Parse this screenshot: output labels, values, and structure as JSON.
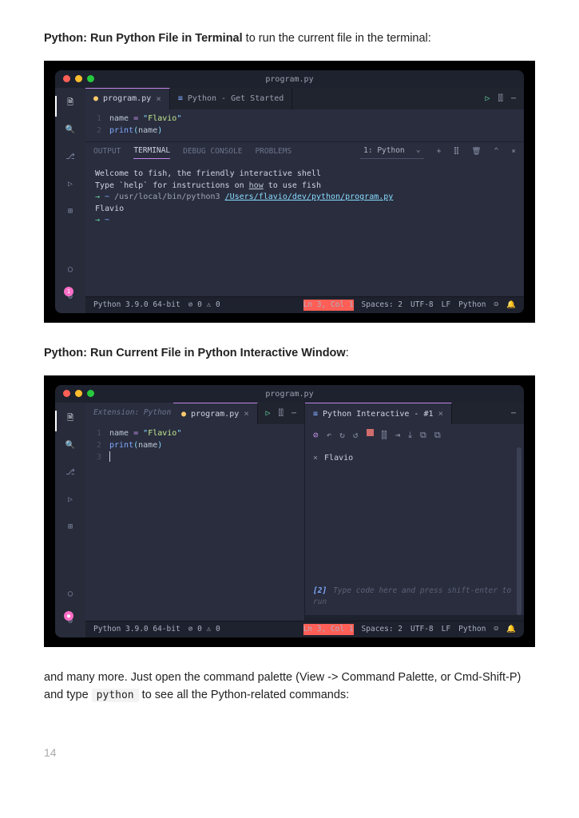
{
  "intro": {
    "bold1": "Python: Run Python File in Terminal",
    "rest1": " to run the current file in the terminal:",
    "bold2": "Python: Run Current File in Python Interactive Window",
    "colon2": ":",
    "outro1": "and many more. Just open the command palette (View -> Command Palette, or Cmd-Shift-P) and type ",
    "code": "python",
    "outro2": " to see all the Python-related commands:",
    "pagenum": "14"
  },
  "shot1": {
    "title": "program.py",
    "tabs": [
      {
        "icon": "●",
        "label": "program.py",
        "close": "×",
        "active": true
      },
      {
        "icon": "≡",
        "label": "Python - Get Started",
        "active": false
      }
    ],
    "tab_actions": {
      "run": "▷",
      "split": "⫿⫿",
      "more": "⋯"
    },
    "editor": {
      "l1_gutter": "1",
      "l1_name": "name ",
      "l1_eq": "=",
      "l1_sp": " ",
      "l1_q1": "\"",
      "l1_str": "Flavio",
      "l1_q2": "\"",
      "l2_gutter": "2",
      "l2_fn": "print",
      "l2_p1": "(",
      "l2_arg": "name",
      "l2_p2": ")"
    },
    "panel": {
      "tabs": {
        "output": "OUTPUT",
        "terminal": "TERMINAL",
        "debug": "DEBUG CONSOLE",
        "problems": "PROBLEMS"
      },
      "drop": "1: Python",
      "icons": {
        "plus": "+",
        "split": "⫿⫿",
        "trash": "🗑",
        "caret": "^",
        "close": "×"
      }
    },
    "term": {
      "l1": "Welcome to fish, the friendly interactive shell",
      "l2a": "Type `help` for instructions on ",
      "l2u": "how",
      "l2b": " to use fish",
      "l3arw": "→",
      "l3tilde": " ~ ",
      "l3path": "/usr/local/bin/python3 ",
      "l3link": "/Users/flavio/dev/python/program.py",
      "l4": "Flavio",
      "l5arw": "→",
      "l5tilde": " ~ "
    },
    "status": {
      "py": "Python 3.9.0 64-bit",
      "err": "⊘ 0 ⚠ 0",
      "ln": "Ln 3, Col 1",
      "sp": "Spaces: 2",
      "enc": "UTF-8",
      "lf": "LF",
      "lang": "Python",
      "fb": "☺",
      "bell": "🔔"
    },
    "badge": "1"
  },
  "shot2": {
    "title": "program.py",
    "left_ext_tab": "Extension: Python",
    "tabs_left": {
      "icon": "●",
      "label": "program.py",
      "close": "×"
    },
    "left_actions": {
      "run": "▷",
      "split": "⫿⫿",
      "more": "⋯"
    },
    "editor": {
      "l1_gutter": "1",
      "l1_name": "name ",
      "l1_eq": "=",
      "l1_sp": " ",
      "l1_q1": "\"",
      "l1_str": "Flavio",
      "l1_q2": "\"",
      "l2_gutter": "2",
      "l2_fn": "print",
      "l2_arg": "name",
      "l3_gutter": "3"
    },
    "right_tab": {
      "icon": "≡",
      "label": "Python Interactive - #1",
      "close": "×"
    },
    "right_actions": {
      "more": "⋯"
    },
    "intbar": {
      "i1": "⊘",
      "i2": "↶",
      "i3": "↻",
      "i4": "↺",
      "stop": "■",
      "i5": "⫿⫿",
      "i6": "⇥",
      "i7": "⤓",
      "i8": "⧉",
      "i9": "⧉"
    },
    "out": {
      "x": "×",
      "val": "Flavio"
    },
    "placeholder_lbl": "[2]",
    "placeholder_txt": "Type code here and press shift-enter to run",
    "status": {
      "py": "Python 3.9.0 64-bit",
      "err": "⊘ 0 ⚠ 0",
      "ln": "Ln 3, Col 1",
      "sp": "Spaces: 2",
      "enc": "UTF-8",
      "lf": "LF",
      "lang": "Python",
      "fb": "☺",
      "bell": "🔔"
    },
    "badge": "●"
  }
}
